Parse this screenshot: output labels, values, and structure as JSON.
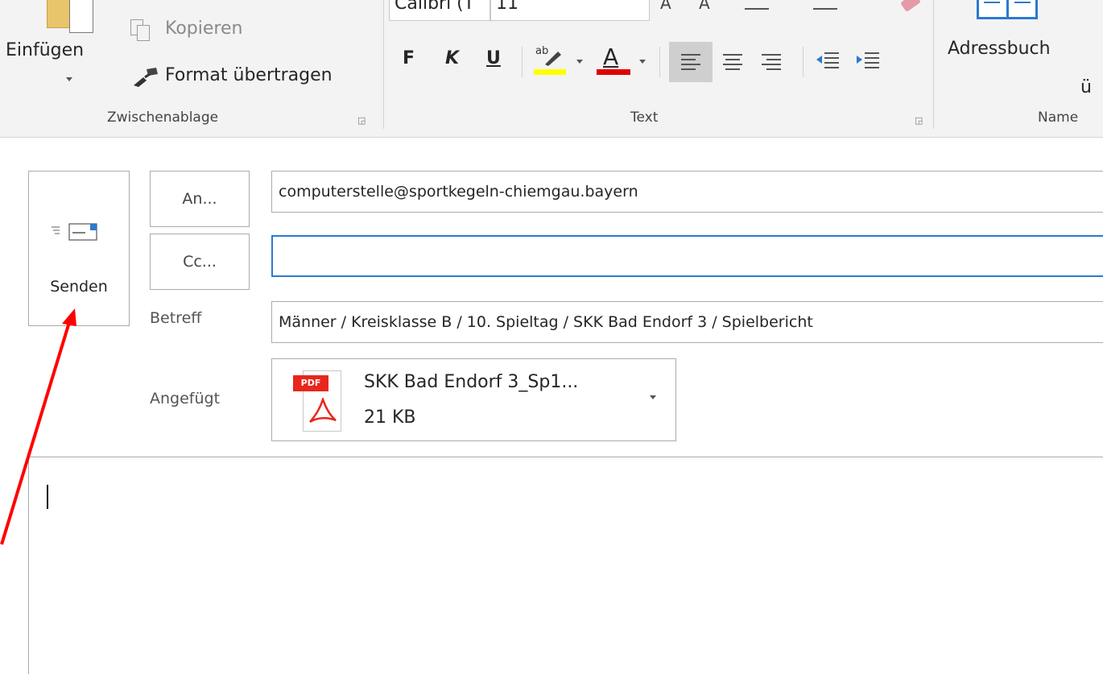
{
  "ribbon": {
    "clipboard": {
      "paste_label": "Einfügen",
      "copy_label": "Kopieren",
      "format_painter_label": "Format übertragen",
      "group_label": "Zwischenablage"
    },
    "text": {
      "font_name": "Calibri (T",
      "font_size": "11",
      "bold_label": "F",
      "italic_label": "K",
      "underline_label": "U",
      "highlight_color": "#ffff00",
      "font_color": "#e00000",
      "group_label": "Text"
    },
    "names": {
      "address_book_label": "Adressbuch",
      "check_names_fragment": "ü",
      "group_label": "Name"
    }
  },
  "compose": {
    "send_label": "Senden",
    "to_button_label": "An...",
    "cc_button_label": "Cc...",
    "to_value": "computerstelle@sportkegeln-chiemgau.bayern",
    "cc_value": "",
    "subject_label": "Betreff",
    "subject_value": "Männer / Kreisklasse B / 10. Spieltag / SKK Bad Endorf 3 / Spielbericht",
    "attached_label": "Angefügt",
    "attachment": {
      "name": "SKK Bad Endorf 3_Sp1...",
      "size": "21 KB",
      "badge": "PDF"
    },
    "body_text": ""
  },
  "colors": {
    "accent_focus": "#2b79d0",
    "annotation_arrow": "#ff0000"
  }
}
